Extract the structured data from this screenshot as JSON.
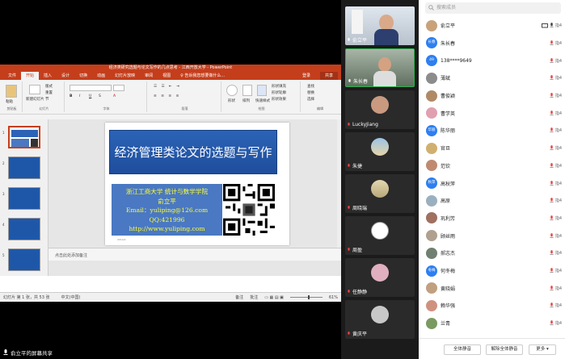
{
  "ppt": {
    "window_title": "经济类研究选题与论文写作的几点思考 - 江西开放大学 - PowerPoint",
    "tabs": [
      "文件",
      "开始",
      "插入",
      "设计",
      "切换",
      "动画",
      "幻灯片放映",
      "审阅",
      "视图",
      "♀ 告诉我您想要做什么..."
    ],
    "login": "登录",
    "share": "共享",
    "ribbon": {
      "paste": "粘贴",
      "new_slide": "新建幻灯片",
      "clipboard": "剪贴板",
      "slides": "幻灯片",
      "font": "字体",
      "paragraph": "段落",
      "drawing": "绘图",
      "editing": "编辑",
      "layout": "版式",
      "reset": "重置",
      "section": "节",
      "shape": "形状",
      "arrange": "排列",
      "quick_styles": "快速样式",
      "shape_fill": "形状填充",
      "shape_outline": "形状轮廓",
      "shape_effect": "形状效果",
      "find": "查找",
      "replace": "替换",
      "select": "选择"
    },
    "thumb_numbers": [
      "1",
      "2",
      "3",
      "4",
      "5"
    ],
    "slide": {
      "title": "经济管理类论文的选题与写作",
      "line1": "浙江工商大学 统计与数学学院",
      "line2": "俞立平",
      "line3": "Email：yuliping@126.com",
      "line4": "QQ:421996",
      "line5": "http://www.yuliping.com",
      "date": "2014/2"
    },
    "notes": "点击此处添加备注",
    "status": {
      "slide_count": "幻灯片 第 1 张，共 53 张",
      "lang": "中文(中国)",
      "notes_btn": "备注",
      "comments_btn": "批注",
      "zoom": "61%"
    }
  },
  "share_footer": "俞立平的屏幕共享",
  "videos": [
    {
      "name": "俞立平"
    },
    {
      "name": "朱长春"
    },
    {
      "name": "LuckyJiang"
    },
    {
      "name": "朱捷"
    },
    {
      "name": "周晓瑞"
    },
    {
      "name": "周盈"
    },
    {
      "name": "任静静"
    },
    {
      "name": "黄庆平"
    }
  ],
  "members": {
    "search_placeholder": "搜索成员",
    "list": [
      {
        "name": "俞立平",
        "avatar": "",
        "color": "#c9a27a",
        "share": true,
        "mic": true
      },
      {
        "name": "朱长春",
        "avatar": "长春",
        "color": "#2e7ff0",
        "share": false,
        "mic": true
      },
      {
        "name": "138****9649",
        "avatar": "49",
        "color": "#2e7ff0",
        "share": false,
        "mic": true
      },
      {
        "name": "薄斌",
        "avatar": "",
        "color": "#8c8c8c",
        "share": false,
        "mic": true
      },
      {
        "name": "曹俊颖",
        "avatar": "",
        "color": "#b08a66",
        "share": false,
        "mic": true
      },
      {
        "name": "曹学英",
        "avatar": "",
        "color": "#e0a0b0",
        "share": false,
        "mic": true
      },
      {
        "name": "陈华丽",
        "avatar": "华丽",
        "color": "#2e7ff0",
        "share": false,
        "mic": true
      },
      {
        "name": "官旦",
        "avatar": "",
        "color": "#d0b070",
        "share": false,
        "mic": true
      },
      {
        "name": "范钦",
        "avatar": "",
        "color": "#c08a70",
        "share": false,
        "mic": true
      },
      {
        "name": "高秋萍",
        "avatar": "秋萍",
        "color": "#2e7ff0",
        "share": false,
        "mic": true
      },
      {
        "name": "高原",
        "avatar": "",
        "color": "#9ab0c0",
        "share": false,
        "mic": true
      },
      {
        "name": "巩利芳",
        "avatar": "",
        "color": "#a07060",
        "share": false,
        "mic": true
      },
      {
        "name": "顾丝雨",
        "avatar": "",
        "color": "#b0a090",
        "share": false,
        "mic": true
      },
      {
        "name": "郝志杰",
        "avatar": "",
        "color": "#708070",
        "share": false,
        "mic": true
      },
      {
        "name": "何冬梅",
        "avatar": "冬梅",
        "color": "#2e7ff0",
        "share": false,
        "mic": true
      },
      {
        "name": "黄晓娟",
        "avatar": "",
        "color": "#c0a080",
        "share": false,
        "mic": true
      },
      {
        "name": "赖华强",
        "avatar": "",
        "color": "#d09080",
        "share": false,
        "mic": true
      },
      {
        "name": "兰青",
        "avatar": "",
        "color": "#7a9a60",
        "share": false,
        "mic": true
      }
    ],
    "muted_label": "指4",
    "mute_all": "全体静音",
    "unmute_all": "解除全体静音",
    "more": "更多 ▾"
  },
  "colors": {
    "ppt_accent": "#c43e1c",
    "slide_blue": "#2c63b6",
    "active_green": "#29b34a",
    "zoom_blue": "#2e7ff0"
  }
}
